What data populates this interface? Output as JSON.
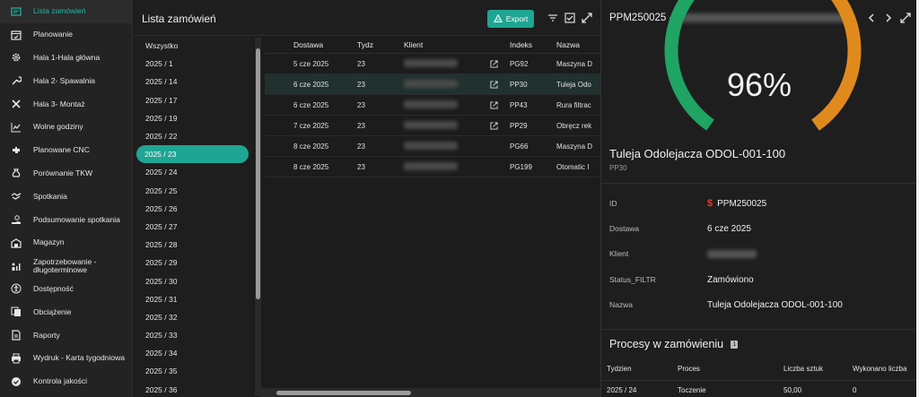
{
  "sidebar": {
    "items": [
      {
        "label": "Lista zamówień",
        "icon": "list-icon",
        "active": true
      },
      {
        "label": "Planowanie",
        "icon": "calendar-icon"
      },
      {
        "label": "Hala 1-Hala główna",
        "icon": "gear-icon"
      },
      {
        "label": "Hala 2- Spawalnia",
        "icon": "wrench-icon"
      },
      {
        "label": "Hala 3- Montaż",
        "icon": "tools-icon"
      },
      {
        "label": "Wolne godziny",
        "icon": "chart-line-icon"
      },
      {
        "label": "Planowane CNC",
        "icon": "puzzle-icon"
      },
      {
        "label": "Porównanie TKW",
        "icon": "money-bag-icon"
      },
      {
        "label": "Spotkania",
        "icon": "handshake-icon"
      },
      {
        "label": "Podsumowanie spotkania",
        "icon": "hand-money-icon"
      },
      {
        "label": "Magazyn",
        "icon": "warehouse-icon"
      },
      {
        "label": "Zapotrzebowanie - długoterminowe",
        "icon": "people-chart-icon"
      },
      {
        "label": "Dostępność",
        "icon": "accessibility-icon"
      },
      {
        "label": "Obciążenie",
        "icon": "copy-icon"
      },
      {
        "label": "Raporty",
        "icon": "document-icon"
      },
      {
        "label": "Wydruk - Karta tygodniowa",
        "icon": "printer-icon"
      },
      {
        "label": "Kontrola jakości",
        "icon": "check-circle-icon"
      }
    ]
  },
  "header": {
    "title": "Lista zamówień",
    "export_label": "Export"
  },
  "weeks": {
    "items": [
      "Wszystko",
      "2025 / 1",
      "2025 / 14",
      "2025 / 17",
      "2025 / 19",
      "2025 / 22",
      "2025 / 23",
      "2025 / 24",
      "2025 / 25",
      "2025 / 26",
      "2025 / 27",
      "2025 / 28",
      "2025 / 29",
      "2025 / 30",
      "2025 / 31",
      "2025 / 32",
      "2025 / 33",
      "2025 / 34",
      "2025 / 35",
      "2025 / 36"
    ],
    "selected": "2025 / 23"
  },
  "table": {
    "columns": [
      "Dostawa",
      "Tydz",
      "Klient",
      "Indeks",
      "Nazwa"
    ],
    "rows": [
      {
        "dostawa": "5 cze 2025",
        "tydz": "23",
        "link": true,
        "indeks": "PG92",
        "nazwa": "Maszyna D"
      },
      {
        "dostawa": "6 cze 2025",
        "tydz": "23",
        "link": true,
        "indeks": "PP30",
        "nazwa": "Tuleja Odo",
        "selected": true
      },
      {
        "dostawa": "6 cze 2025",
        "tydz": "23",
        "link": true,
        "indeks": "PP43",
        "nazwa": "Rura filtrac"
      },
      {
        "dostawa": "7 cze 2025",
        "tydz": "23",
        "link": true,
        "indeks": "PP29",
        "nazwa": "Obręcz rek"
      },
      {
        "dostawa": "8 cze 2025",
        "tydz": "23",
        "link": false,
        "indeks": "PG66",
        "nazwa": "Maszyna D"
      },
      {
        "dostawa": "8 cze 2025",
        "tydz": "23",
        "link": false,
        "indeks": "PG199",
        "nazwa": "Otomatic I"
      }
    ]
  },
  "detail": {
    "title_prefix": "PPM250025 -",
    "percent": "96%",
    "percent_value": 0.96,
    "product_name": "Tuleja Odolejacza ODOL-001-100",
    "product_code": "PP30",
    "fields": [
      {
        "key": "ID",
        "value": "PPM250025",
        "dollar": "$"
      },
      {
        "key": "Dostawa",
        "value": "6 cze 2025"
      },
      {
        "key": "Klient",
        "value": ""
      },
      {
        "key": "Status_FILTR",
        "value": "Zamówiono"
      },
      {
        "key": "Nazwa",
        "value": "Tuleja Odolejacza ODOL-001-100"
      }
    ],
    "processes_title": "Procesy w zamówieniu",
    "processes_count": "1",
    "process_columns": [
      "Tydzien",
      "Proces",
      "Liczba sztuk",
      "Wykonano liczba"
    ],
    "process_rows": [
      {
        "tydzien": "2025 / 24",
        "proces": "Toczenie",
        "liczba": "50,00",
        "wykonano": "0"
      }
    ],
    "colors": {
      "left_arc": "#1fa463",
      "right_arc": "#e08a1e"
    }
  },
  "colors": {
    "accent": "#1ea593",
    "active_text": "#26b5a3"
  }
}
